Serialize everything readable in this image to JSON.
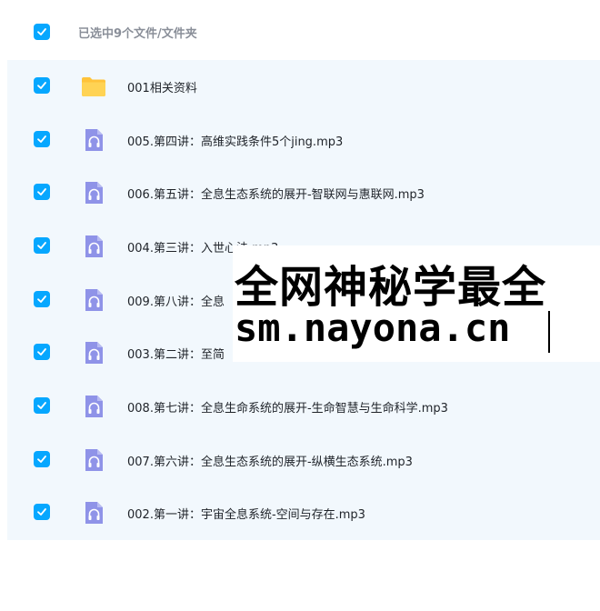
{
  "header": {
    "selection_label": "已选中9个文件/文件夹",
    "select_all_checked": true
  },
  "colors": {
    "checkbox": "#06a7ff",
    "folder": "#ffc33a",
    "audio_icon": "#8f93e8",
    "list_background": "#f2f8fd"
  },
  "files": [
    {
      "name": "001相关资料",
      "type": "folder",
      "icon": "folder-icon",
      "checked": true
    },
    {
      "name": "005.第四讲：高维实践条件5个jing.mp3",
      "type": "audio",
      "icon": "audio-file-icon",
      "checked": true
    },
    {
      "name": "006.第五讲：全息生态系统的展开-智联网与惠联网.mp3",
      "type": "audio",
      "icon": "audio-file-icon",
      "checked": true
    },
    {
      "name": "004.第三讲：入世心法.mp3",
      "type": "audio",
      "icon": "audio-file-icon",
      "checked": true
    },
    {
      "name": "009.第八讲：全息",
      "type": "audio",
      "icon": "audio-file-icon",
      "checked": true
    },
    {
      "name": "003.第二讲：至简",
      "type": "audio",
      "icon": "audio-file-icon",
      "checked": true
    },
    {
      "name": "008.第七讲：全息生命系统的展开-生命智慧与生命科学.mp3",
      "type": "audio",
      "icon": "audio-file-icon",
      "checked": true
    },
    {
      "name": "007.第六讲：全息生态系统的展开-纵横生态系统.mp3",
      "type": "audio",
      "icon": "audio-file-icon",
      "checked": true
    },
    {
      "name": "002.第一讲：宇宙全息系统-空间与存在.mp3",
      "type": "audio",
      "icon": "audio-file-icon",
      "checked": true
    }
  ],
  "watermark": {
    "line1": "全网神秘学最全",
    "line2": "sm.nayona.cn"
  }
}
